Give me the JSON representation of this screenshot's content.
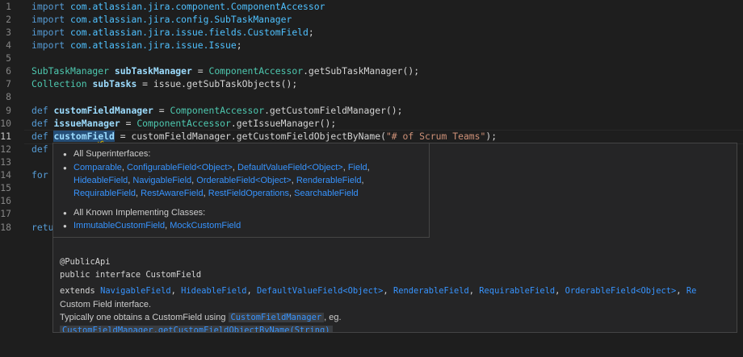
{
  "editor": {
    "line_numbers": [
      "1",
      "2",
      "3",
      "4",
      "5",
      "6",
      "7",
      "8",
      "9",
      "10",
      "11",
      "12",
      "13",
      "14",
      "15",
      "16",
      "17",
      "18"
    ],
    "active_line": "11",
    "l1": {
      "kw": "import",
      "pkg": "com.atlassian.jira.component.ComponentAccessor"
    },
    "l2": {
      "kw": "import",
      "pkg": "com.atlassian.jira.config.SubTaskManager"
    },
    "l3": {
      "kw": "import",
      "pkg": "com.atlassian.jira.issue.fields.CustomField",
      "end": ";"
    },
    "l4": {
      "kw": "import",
      "pkg": "com.atlassian.jira.issue.Issue",
      "end": ";"
    },
    "l6": {
      "type": "SubTaskManager",
      "var": "subTaskManager",
      "eq": " = ",
      "cls": "ComponentAccessor",
      "call": ".getSubTaskManager();"
    },
    "l7": {
      "type": "Collection",
      "var": "subTasks",
      "eq": " = ",
      "rest": "issue.getSubTaskObjects();"
    },
    "l9": {
      "kw": "def",
      "var": "customFieldManager",
      "eq": " = ",
      "cls": "ComponentAccessor",
      "call": ".getCustomFieldManager();"
    },
    "l10": {
      "kw": "def",
      "var": "issueManager",
      "eq": " = ",
      "cls": "ComponentAccessor",
      "call": ".getIssueManager();"
    },
    "l11": {
      "kw": "def",
      "var_a": "customFi",
      "var_b": "e",
      "var_c": "ld",
      "eq": " = ",
      "rest": "customFieldManager.getCustomFieldObjectByName(",
      "str": "\"# of Scrum Teams\"",
      "end": ");"
    },
    "l12": {
      "kw": "def"
    },
    "l14": {
      "kw": "for"
    },
    "l18": {
      "kw": "retu"
    }
  },
  "hover": {
    "superinterfaces_title": "All Superinterfaces:",
    "superinterfaces": [
      "Comparable",
      "ConfigurableField",
      "<Object>",
      "DefaultValueField",
      "<Object>",
      "Field",
      "HideableField",
      "NavigableField",
      "OrderableField",
      "<Object>",
      "RenderableField",
      "RequirableField",
      "RestAwareField",
      "RestFieldOperations",
      "SearchableField"
    ],
    "implementing_title": "All Known Implementing Classes:",
    "implementing": [
      "ImmutableCustomField",
      "MockCustomField"
    ],
    "annotation": "@PublicApi",
    "signature": "public interface CustomField",
    "extends_kw": "extends",
    "extends": [
      "NavigableField",
      "HideableField",
      "DefaultValueField",
      "<Object>",
      "RenderableField",
      "RequirableField",
      "OrderableField",
      "<Object>",
      "Re"
    ],
    "desc1": "Custom Field interface.",
    "desc2_a": "Typically one obtains a CustomField using",
    "desc2_chip": "CustomFieldManager",
    "desc2_b": ", eg.",
    "desc3_chip": "CustomFieldManager.getCustomFieldObjectByName(String)"
  }
}
